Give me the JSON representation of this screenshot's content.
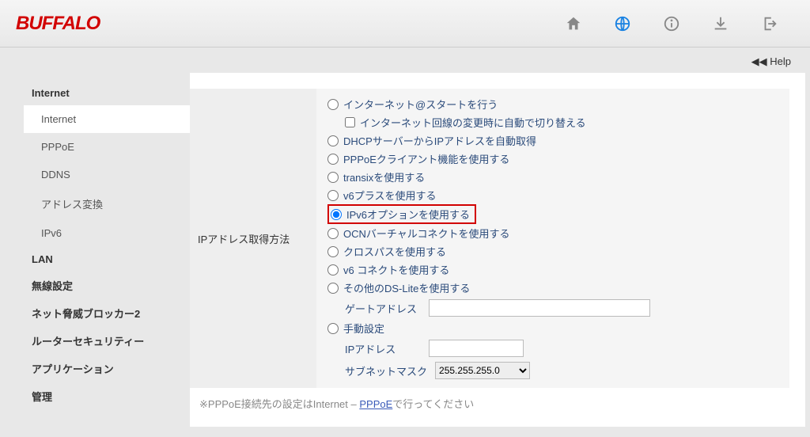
{
  "logo": "BUFFALO",
  "help_label": "◀◀ Help",
  "sidebar": {
    "groups": [
      {
        "label": "Internet",
        "subs": [
          "Internet",
          "PPPoE",
          "DDNS",
          "アドレス変換",
          "IPv6"
        ],
        "activeSub": 0
      },
      {
        "label": "LAN"
      },
      {
        "label": "無線設定"
      },
      {
        "label": "ネット脅威ブロッカー2"
      },
      {
        "label": "ルーターセキュリティー"
      },
      {
        "label": "アプリケーション"
      },
      {
        "label": "管理"
      }
    ]
  },
  "settings": {
    "section_label": "IPアドレス取得方法",
    "options": [
      {
        "label": "インターネット@スタートを行う",
        "checked": false,
        "checkbox": {
          "label": "インターネット回線の変更時に自動で切り替える",
          "checked": false
        }
      },
      {
        "label": "DHCPサーバーからIPアドレスを自動取得",
        "checked": false
      },
      {
        "label": "PPPoEクライアント機能を使用する",
        "checked": false
      },
      {
        "label": "transixを使用する",
        "checked": false
      },
      {
        "label": "v6プラスを使用する",
        "checked": false
      },
      {
        "label": "IPv6オプションを使用する",
        "checked": true,
        "highlight": true
      },
      {
        "label": "OCNバーチャルコネクトを使用する",
        "checked": false
      },
      {
        "label": "クロスパスを使用する",
        "checked": false
      },
      {
        "label": "v6 コネクトを使用する",
        "checked": false
      },
      {
        "label": "その他のDS-Liteを使用する",
        "checked": false,
        "fields": [
          {
            "label": "ゲートアドレス",
            "type": "text",
            "value": ""
          }
        ]
      },
      {
        "label": "手動設定",
        "checked": false,
        "fields": [
          {
            "label": "IPアドレス",
            "type": "text",
            "value": "",
            "small": true
          },
          {
            "label": "サブネットマスク",
            "type": "select",
            "value": "255.255.255.0"
          }
        ]
      }
    ]
  },
  "note": {
    "prefix": "※PPPoE接続先の設定はInternet – ",
    "link": "PPPoE",
    "suffix": "で行ってください"
  }
}
